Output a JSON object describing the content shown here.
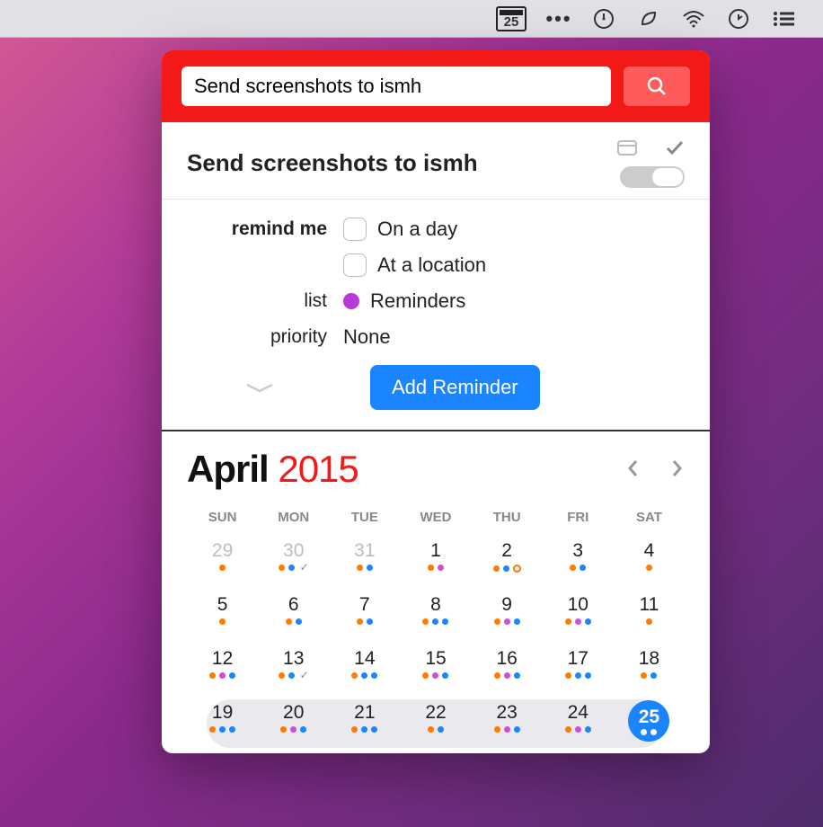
{
  "menubar": {
    "calendar_badge": "25"
  },
  "search": {
    "value": "Send screenshots to ismh",
    "placeholder": ""
  },
  "reminder": {
    "title": "Send screenshots to ismh",
    "remind_me_label": "remind me",
    "on_a_day_label": "On a day",
    "at_location_label": "At a location",
    "list_label": "list",
    "list_value": "Reminders",
    "list_color": "#b53ad6",
    "priority_label": "priority",
    "priority_value": "None",
    "add_button": "Add Reminder"
  },
  "calendar": {
    "month": "April",
    "year": "2015",
    "dow": [
      "SUN",
      "MON",
      "TUE",
      "WED",
      "THU",
      "FRI",
      "SAT"
    ],
    "weeks": [
      [
        {
          "n": "29",
          "muted": true,
          "dots": [
            "o"
          ]
        },
        {
          "n": "30",
          "muted": true,
          "dots": [
            "o",
            "b"
          ],
          "tick": true
        },
        {
          "n": "31",
          "muted": true,
          "dots": [
            "o",
            "b"
          ]
        },
        {
          "n": "1",
          "dots": [
            "o",
            "p"
          ]
        },
        {
          "n": "2",
          "dots": [
            "o",
            "b",
            "ring"
          ]
        },
        {
          "n": "3",
          "dots": [
            "o",
            "b"
          ]
        },
        {
          "n": "4",
          "dots": [
            "o"
          ]
        }
      ],
      [
        {
          "n": "5",
          "dots": [
            "o"
          ]
        },
        {
          "n": "6",
          "dots": [
            "o",
            "b"
          ]
        },
        {
          "n": "7",
          "dots": [
            "o",
            "b"
          ]
        },
        {
          "n": "8",
          "dots": [
            "o",
            "b",
            "b"
          ]
        },
        {
          "n": "9",
          "dots": [
            "o",
            "p",
            "b"
          ]
        },
        {
          "n": "10",
          "dots": [
            "o",
            "p",
            "b"
          ]
        },
        {
          "n": "11",
          "dots": [
            "o"
          ]
        }
      ],
      [
        {
          "n": "12",
          "dots": [
            "o",
            "p",
            "b"
          ]
        },
        {
          "n": "13",
          "dots": [
            "o",
            "b"
          ],
          "tick": true
        },
        {
          "n": "14",
          "dots": [
            "o",
            "b",
            "b"
          ]
        },
        {
          "n": "15",
          "dots": [
            "o",
            "p",
            "b"
          ]
        },
        {
          "n": "16",
          "dots": [
            "o",
            "p",
            "b"
          ]
        },
        {
          "n": "17",
          "dots": [
            "o",
            "b",
            "b"
          ]
        },
        {
          "n": "18",
          "dots": [
            "o",
            "b"
          ]
        }
      ],
      [
        {
          "n": "19",
          "dots": [
            "o",
            "b",
            "b"
          ]
        },
        {
          "n": "20",
          "dots": [
            "o",
            "p",
            "b"
          ]
        },
        {
          "n": "21",
          "dots": [
            "o",
            "b",
            "b"
          ]
        },
        {
          "n": "22",
          "dots": [
            "o",
            "b"
          ]
        },
        {
          "n": "23",
          "dots": [
            "o",
            "p",
            "b"
          ]
        },
        {
          "n": "24",
          "dots": [
            "o",
            "p",
            "b"
          ]
        },
        {
          "n": "25",
          "today": true,
          "dots": [
            "w",
            "w"
          ]
        }
      ]
    ],
    "current_week_index": 3
  }
}
